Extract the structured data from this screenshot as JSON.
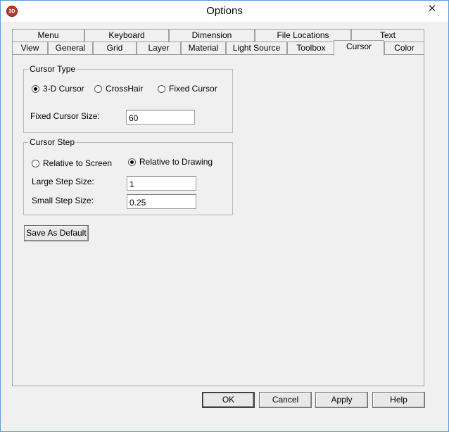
{
  "window": {
    "title": "Options",
    "app_icon": "3D",
    "close_glyph": "✕"
  },
  "tabs_row1": [
    "Menu",
    "Keyboard",
    "Dimension",
    "File Locations",
    "Text"
  ],
  "tabs_row2": [
    "View",
    "General",
    "Grid",
    "Layer",
    "Material",
    "Light Source",
    "Toolbox",
    "Cursor",
    "Color"
  ],
  "active_tab": "Cursor",
  "cursor_type": {
    "title": "Cursor Type",
    "options": [
      {
        "label": "3-D Cursor",
        "selected": true
      },
      {
        "label": "CrossHair",
        "selected": false
      },
      {
        "label": "Fixed Cursor",
        "selected": false
      }
    ],
    "size_label": "Fixed Cursor Size:",
    "size_value": "60"
  },
  "cursor_step": {
    "title": "Cursor Step",
    "options": [
      {
        "label": "Relative to Screen",
        "selected": false
      },
      {
        "label": "Relative to Drawing",
        "selected": true
      }
    ],
    "large_label": "Large Step Size:",
    "large_value": "1",
    "small_label": "Small Step Size:",
    "small_value": "0.25"
  },
  "save_default_label": "Save As Default",
  "buttons": {
    "ok": "OK",
    "cancel": "Cancel",
    "apply": "Apply",
    "help": "Help"
  }
}
